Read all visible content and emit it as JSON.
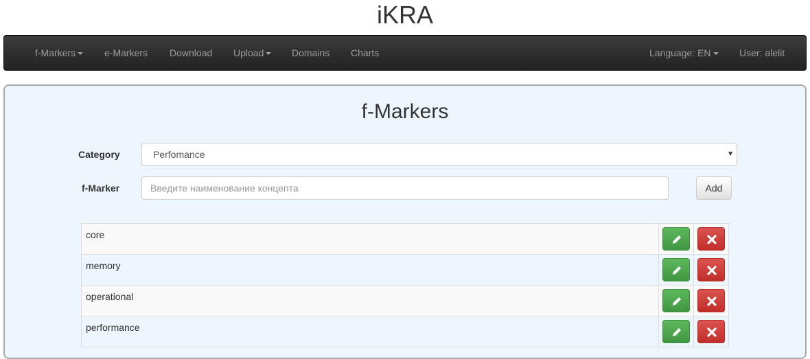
{
  "app": {
    "title": "iKRA"
  },
  "nav": {
    "left": [
      {
        "label": "f-Markers",
        "dropdown": true
      },
      {
        "label": "e-Markers",
        "dropdown": false
      },
      {
        "label": "Download",
        "dropdown": false
      },
      {
        "label": "Upload",
        "dropdown": true
      },
      {
        "label": "Domains",
        "dropdown": false
      },
      {
        "label": "Charts",
        "dropdown": false
      }
    ],
    "language": {
      "label": "Language: EN",
      "dropdown": true
    },
    "user": {
      "label": "User: alelit"
    }
  },
  "page": {
    "title": "f-Markers",
    "category_label": "Category",
    "category_value": "Perfomance",
    "fmarker_label": "f-Marker",
    "fmarker_placeholder": "Введите наименование концепта",
    "fmarker_value": "",
    "add_label": "Add"
  },
  "markers": [
    "core",
    "memory",
    "operational",
    "performance"
  ],
  "icons": {
    "edit": "pencil-icon",
    "delete": "close-icon",
    "dropdown": "caret-down-icon"
  },
  "colors": {
    "edit": "#5cb85c",
    "delete": "#d9534f",
    "navbar": "#222222",
    "panel": "#eef6fd"
  }
}
